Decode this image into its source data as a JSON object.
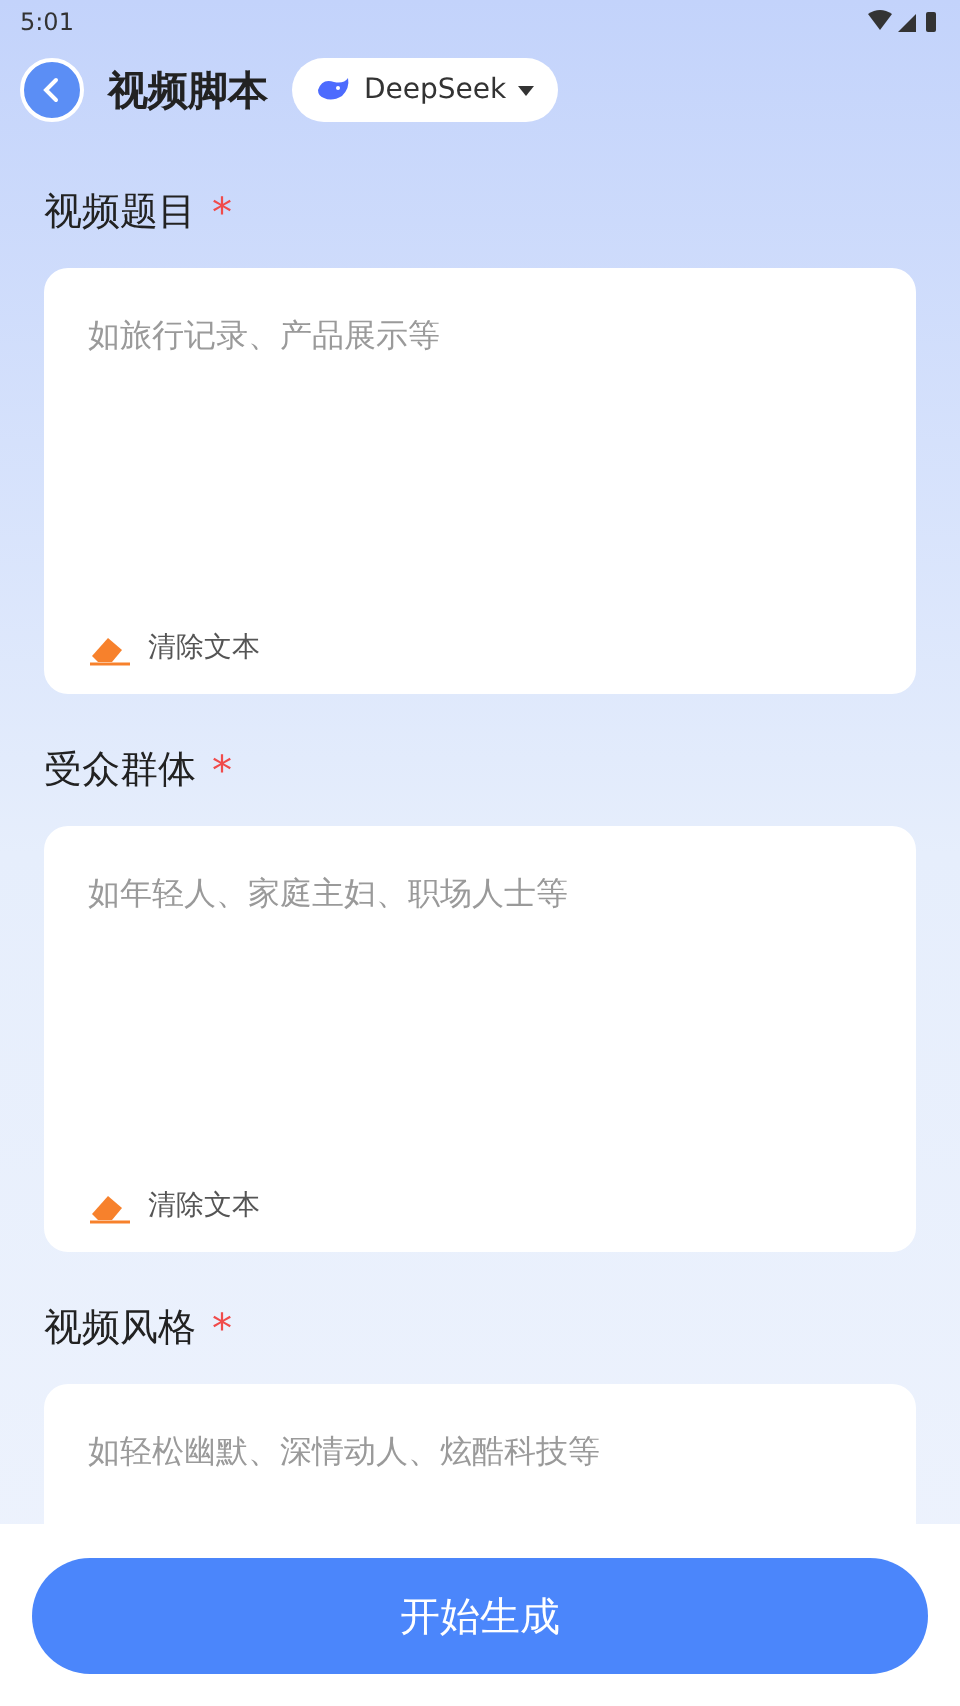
{
  "status_bar": {
    "time": "5:01"
  },
  "header": {
    "title": "视频脚本",
    "model": {
      "label": "DeepSeek"
    }
  },
  "fields": [
    {
      "label": "视频题目",
      "required_mark": "*",
      "placeholder": "如旅行记录、产品展示等",
      "clear_label": "清除文本"
    },
    {
      "label": "受众群体",
      "required_mark": "*",
      "placeholder": "如年轻人、家庭主妇、职场人士等",
      "clear_label": "清除文本"
    },
    {
      "label": "视频风格",
      "required_mark": "*",
      "placeholder": "如轻松幽默、深情动人、炫酷科技等"
    }
  ],
  "submit_button": "开始生成"
}
